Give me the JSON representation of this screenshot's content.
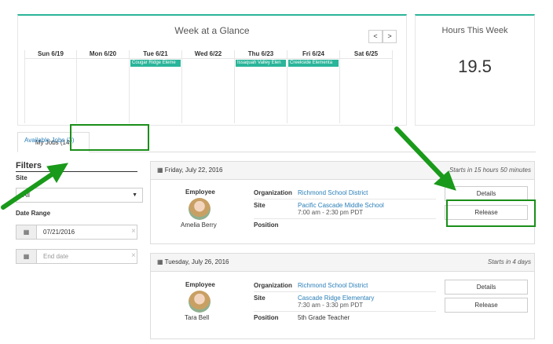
{
  "week": {
    "title": "Week at a Glance",
    "prev_label": "<",
    "next_label": ">",
    "days": [
      {
        "label": "Sun 6/19",
        "event": ""
      },
      {
        "label": "Mon 6/20",
        "event": ""
      },
      {
        "label": "Tue 6/21",
        "event": "Cougar Ridge Eleme"
      },
      {
        "label": "Wed 6/22",
        "event": ""
      },
      {
        "label": "Thu 6/23",
        "event": "Issaquah Valley Elen"
      },
      {
        "label": "Fri 6/24",
        "event": "Creekside Elementa"
      },
      {
        "label": "Sat 6/25",
        "event": ""
      }
    ]
  },
  "hours": {
    "title": "Hours This Week",
    "value": "19.5"
  },
  "tabs": {
    "available": "Available Jobs (3)",
    "my_jobs": "My Jobs (14)"
  },
  "filters": {
    "title": "Filters",
    "site_label": "Site",
    "site_value": "All",
    "date_label": "Date Range",
    "start_date": "07/21/2016",
    "end_placeholder": "End date",
    "clear_symbol": "×"
  },
  "jobs": [
    {
      "date": "Friday, July 22, 2016",
      "starts": "Starts in 15 hours 50 minutes",
      "employee_label": "Employee",
      "employee_name": "Amelia Berry",
      "org_label": "Organization",
      "org": "Richmond School District",
      "site_label": "Site",
      "site": "Pacific Cascade Middle School",
      "time": "7:00 am - 2:30 pm PDT",
      "position_label": "Position",
      "position": "",
      "details_label": "Details",
      "release_label": "Release"
    },
    {
      "date": "Tuesday, July 26, 2016",
      "starts": "Starts in 4 days",
      "employee_label": "Employee",
      "employee_name": "Tara Bell",
      "org_label": "Organization",
      "org": "Richmond School District",
      "site_label": "Site",
      "site": "Cascade Ridge Elementary",
      "time": "7:30 am - 3:30 pm PDT",
      "position_label": "Position",
      "position": "5th Grade Teacher",
      "details_label": "Details",
      "release_label": "Release"
    }
  ],
  "colors": {
    "accent": "#2bb59a",
    "link": "#2a7fb8",
    "highlight": "#1a8f1a"
  }
}
